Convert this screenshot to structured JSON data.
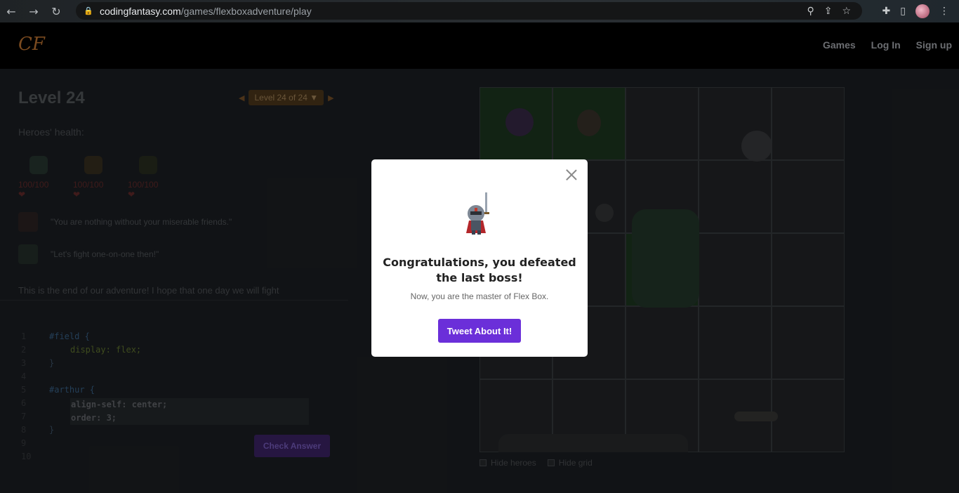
{
  "browser": {
    "url_host": "codingfantasy.com",
    "url_path": "/games/flexboxadventure/play"
  },
  "site": {
    "logo": "CF",
    "nav": [
      "Games",
      "Log In",
      "Sign up"
    ]
  },
  "level": {
    "title": "Level 24",
    "selector": "Level 24 of 24 ▼",
    "health_label": "Heroes' health:",
    "heroes": [
      {
        "hp": "100/100 ❤"
      },
      {
        "hp": "100/100 ❤"
      },
      {
        "hp": "100/100 ❤"
      }
    ],
    "quotes": [
      "\"You are nothing without your miserable friends.\"",
      "\"Let's fight one-on-one then!\""
    ],
    "story": "This is the end of our adventure! I hope that one day we will fight"
  },
  "editor": {
    "line_numbers": [
      "1",
      "2",
      "3",
      "4",
      "5",
      "6",
      "7",
      "8",
      "9",
      "10"
    ],
    "lines": [
      "#field {",
      "display: flex;",
      "}",
      "",
      "#arthur {",
      "",
      "",
      "}",
      "",
      ""
    ],
    "input_lines": [
      "align-self: center;",
      "order: 3;"
    ],
    "check_label": "Check Answer"
  },
  "board_options": {
    "hide_heroes": "Hide heroes",
    "hide_grid": "Hide grid"
  },
  "modal": {
    "title": "Congratulations, you defeated the last boss!",
    "subtitle": "Now, you are the master of Flex Box.",
    "button": "Tweet About It!"
  }
}
